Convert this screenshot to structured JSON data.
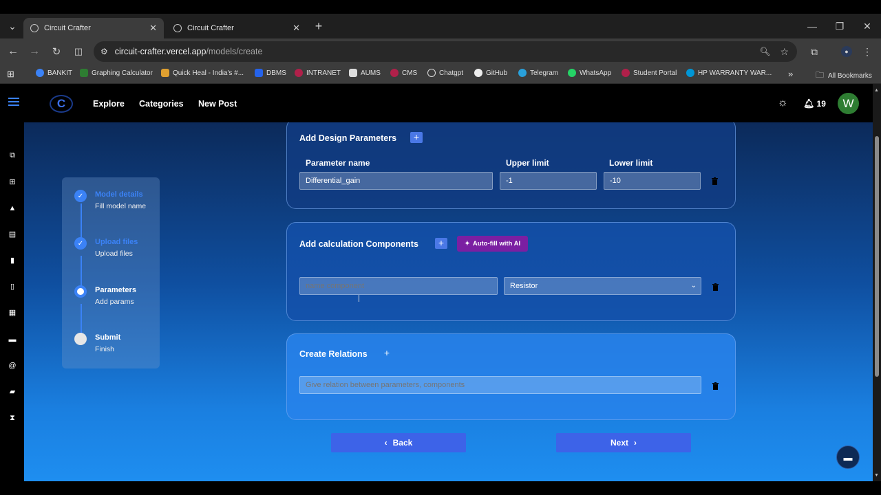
{
  "browser": {
    "tabs": [
      {
        "title": "Circuit Crafter",
        "active": true
      },
      {
        "title": "Circuit Crafter",
        "active": false
      }
    ],
    "url_host": "circuit-crafter.vercel.app",
    "url_path": "/models/create",
    "bookmarks": [
      "BANKIT",
      "Graphing Calculator",
      "Quick Heal - India's #...",
      "DBMS",
      "INTRANET",
      "AUMS",
      "CMS",
      "Chatgpt",
      "GitHub",
      "Telegram",
      "WhatsApp",
      "Student Portal",
      "HP WARRANTY WAR..."
    ],
    "all_bookmarks": "All Bookmarks"
  },
  "navbar": {
    "links": [
      "Explore",
      "Categories",
      "New Post"
    ],
    "notification_count": "19",
    "avatar_letter": "W"
  },
  "stepper": {
    "steps": [
      {
        "title": "Model details",
        "sub": "Fill model name",
        "state": "done"
      },
      {
        "title": "Upload files",
        "sub": "Upload files",
        "state": "done"
      },
      {
        "title": "Parameters",
        "sub": "Add params",
        "state": "current"
      },
      {
        "title": "Submit",
        "sub": "Finish",
        "state": "pending"
      }
    ]
  },
  "design_params": {
    "title": "Add Design Parameters",
    "col_name": "Parameter name",
    "col_upper": "Upper limit",
    "col_lower": "Lower limit",
    "row": {
      "name": "Differential_gain",
      "upper": "-1",
      "lower": "-10"
    }
  },
  "calc_components": {
    "title": "Add calculation Components",
    "ai_button": "Auto-fill with AI",
    "name_placeholder": "name component",
    "type_value": "Resistor"
  },
  "relations": {
    "title": "Create Relations",
    "placeholder": "Give relation between parameters, components"
  },
  "footer": {
    "back": "Back",
    "next": "Next"
  },
  "colors": {
    "accent": "#3d63e8",
    "ai_purple": "#7b1fa2",
    "avatar_green": "#2e7d32"
  }
}
